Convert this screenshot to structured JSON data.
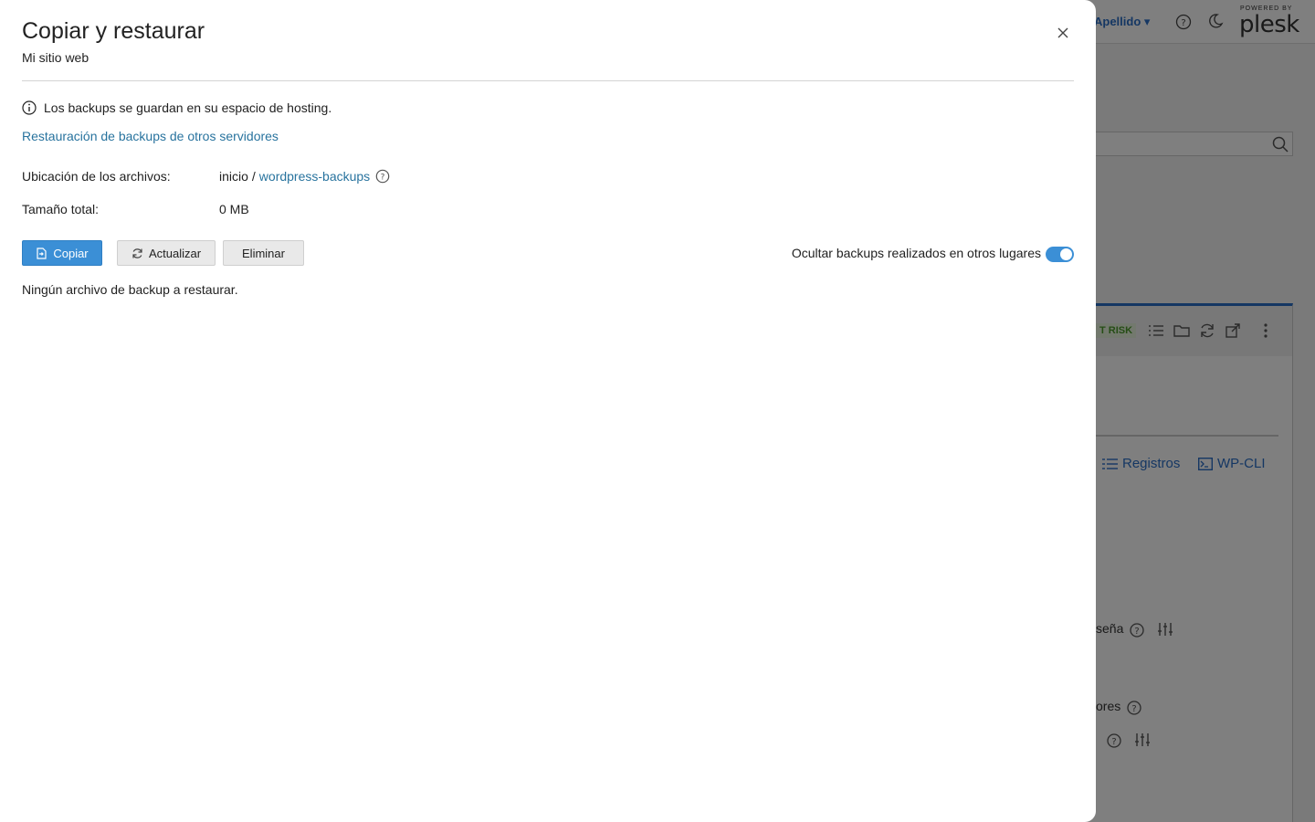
{
  "background": {
    "user_name": "Apellido",
    "logo_small": "POWERED BY",
    "logo_big": "plesk",
    "risk_badge": "T RISK",
    "links": [
      "Registros",
      "WP-CLI"
    ],
    "fragments": [
      "seña",
      "ores"
    ]
  },
  "drawer": {
    "title": "Copiar y restaurar",
    "subtitle": "Mi sitio web",
    "info_text": "Los backups se guardan en su espacio de hosting.",
    "restore_link": "Restauración de backups de otros servidores",
    "location_label": "Ubicación de los archivos:",
    "location_root": "inicio",
    "location_separator": "/",
    "location_folder": "wordpress-backups",
    "size_label": "Tamaño total:",
    "size_value": "0 MB",
    "buttons": {
      "copy": "Copiar",
      "refresh": "Actualizar",
      "delete": "Eliminar"
    },
    "toggle_label": "Ocultar backups realizados en otros lugares",
    "toggle_on": true,
    "empty_message": "Ningún archivo de backup a restaurar."
  },
  "colors": {
    "accent": "#3b8fd6",
    "link": "#28739e",
    "overlay": "rgba(0,0,0,0.5)"
  }
}
